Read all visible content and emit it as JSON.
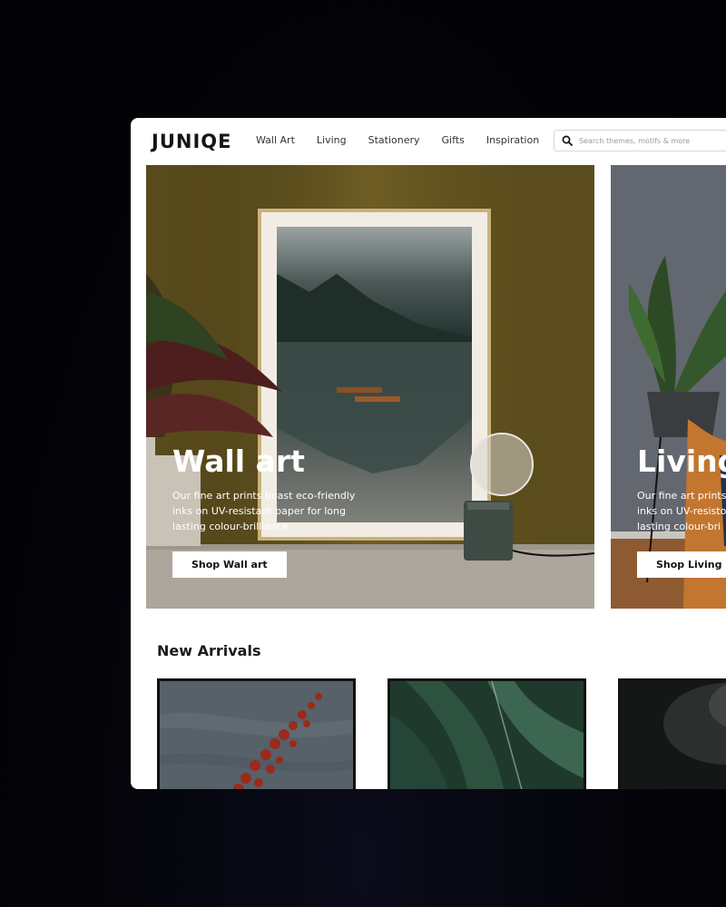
{
  "brand": {
    "logo": "JUNIQE"
  },
  "nav": {
    "items": [
      {
        "label": "Wall Art"
      },
      {
        "label": "Living"
      },
      {
        "label": "Stationery"
      },
      {
        "label": "Gifts"
      },
      {
        "label": "Inspiration"
      }
    ]
  },
  "search": {
    "placeholder": "Search themes, motifs & more",
    "icon": "search-icon"
  },
  "heroes": [
    {
      "title": "Wall art",
      "desc_lines": [
        "Our fine art prints boast eco-friendly",
        "inks on UV-resistant paper for long",
        "lasting colour-brilliance."
      ],
      "button": "Shop Wall art"
    },
    {
      "title": "Living",
      "desc_lines": [
        "Our fine art prints",
        "inks on UV-resisto",
        "lasting colour-bri"
      ],
      "button": "Shop Living"
    }
  ],
  "new_arrivals": {
    "title": "New Arrivals"
  },
  "colors": {
    "hero1_wall": "#6e5d23",
    "hero2_wall": "#6b6f76",
    "button_bg": "#ffffff",
    "page_bg": "#03030a"
  }
}
